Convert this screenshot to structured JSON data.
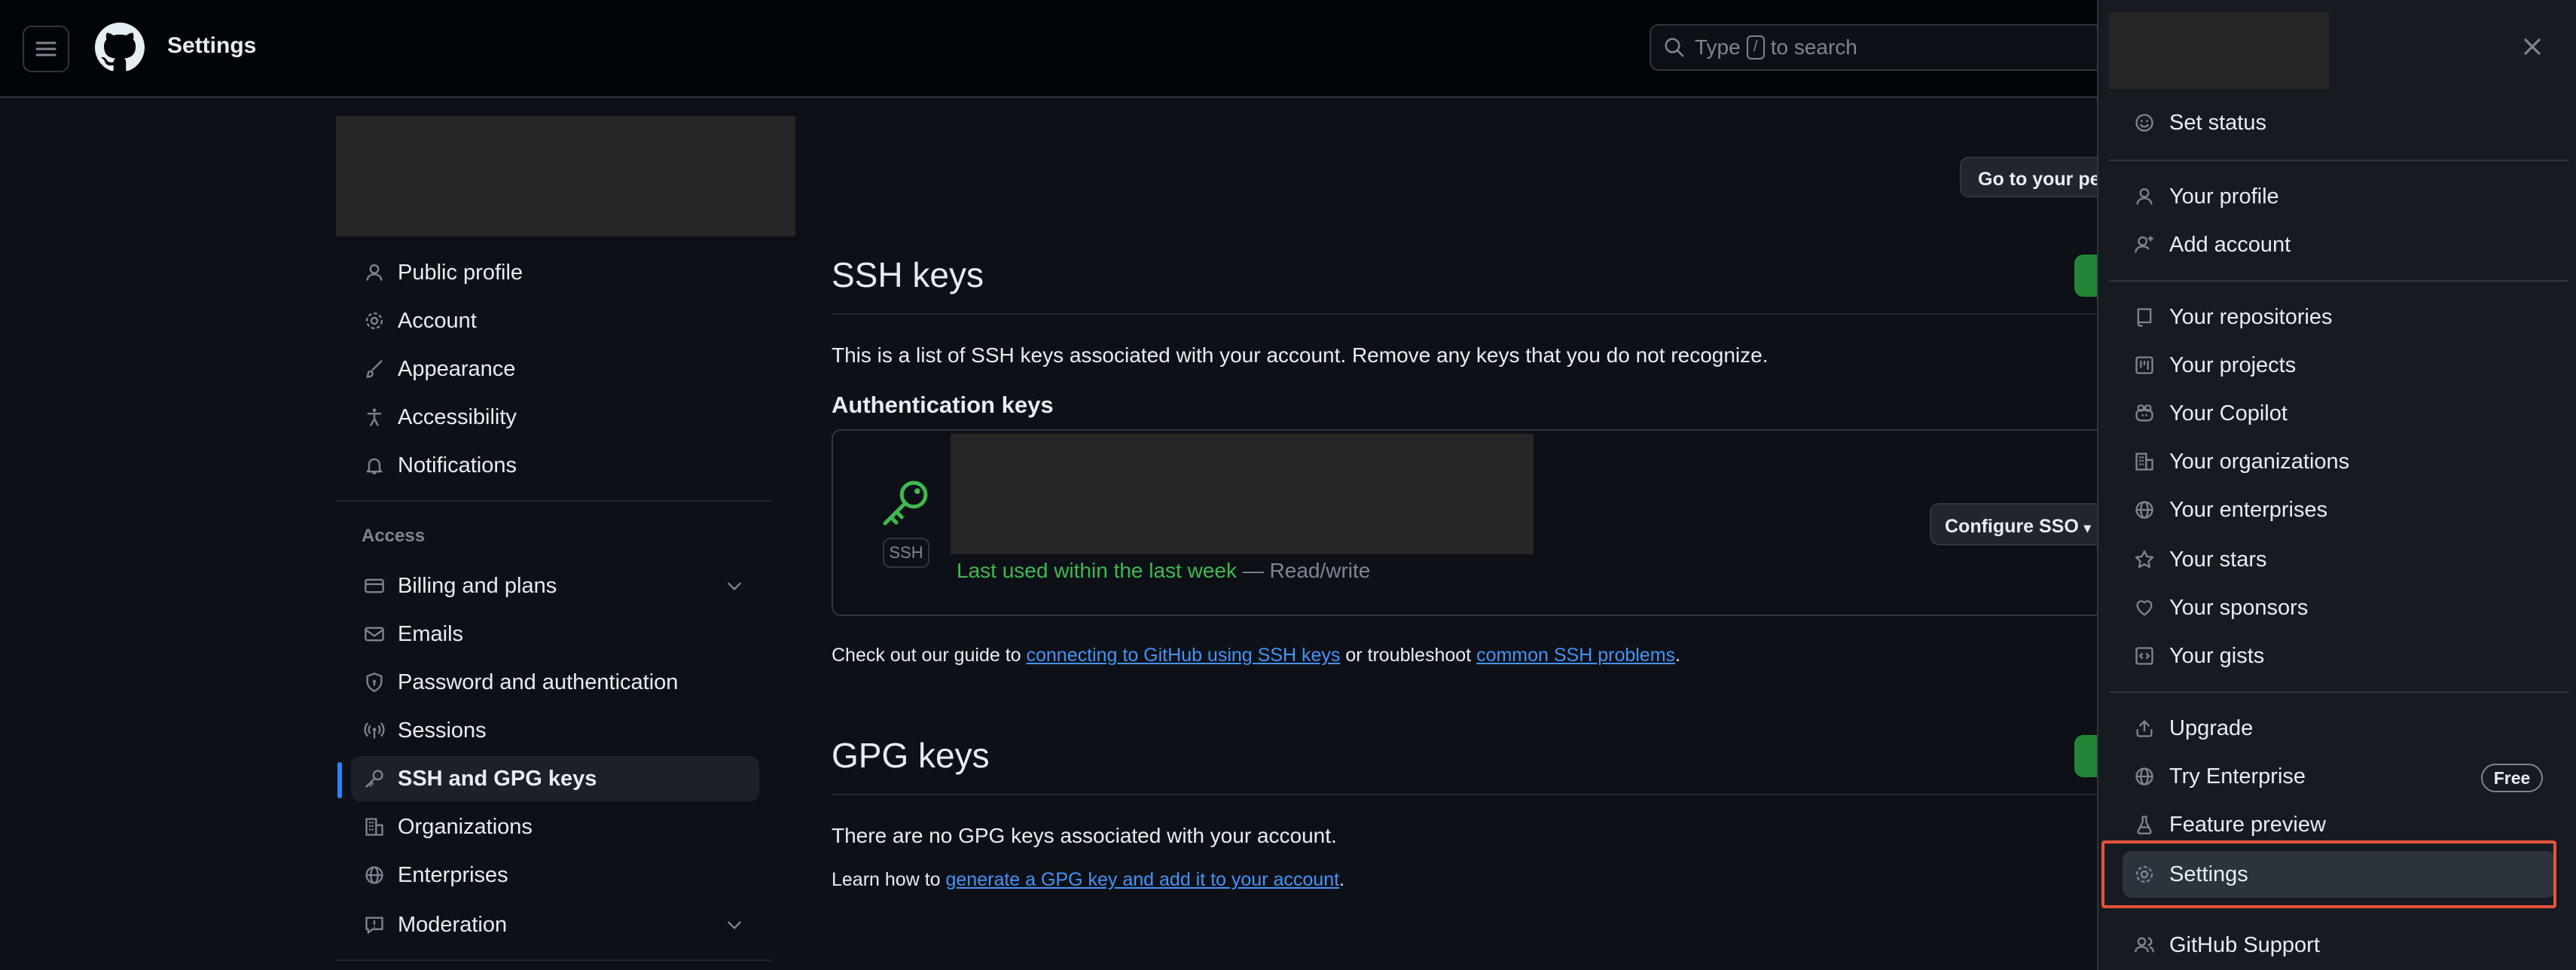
{
  "header": {
    "title": "Settings",
    "search_prefix": "Type",
    "search_key": "/",
    "search_suffix": "to search"
  },
  "sidebar": {
    "items": [
      {
        "label": "Public profile",
        "icon": "person-icon"
      },
      {
        "label": "Account",
        "icon": "gear-icon"
      },
      {
        "label": "Appearance",
        "icon": "paintbrush-icon"
      },
      {
        "label": "Accessibility",
        "icon": "accessibility-icon"
      },
      {
        "label": "Notifications",
        "icon": "bell-icon"
      }
    ],
    "access_heading": "Access",
    "access_items": [
      {
        "label": "Billing and plans",
        "icon": "credit-card-icon"
      },
      {
        "label": "Emails",
        "icon": "mail-icon"
      },
      {
        "label": "Password and authentication",
        "icon": "shield-lock-icon"
      },
      {
        "label": "Sessions",
        "icon": "broadcast-icon"
      },
      {
        "label": "SSH and GPG keys",
        "icon": "key-icon",
        "active": true
      },
      {
        "label": "Organizations",
        "icon": "organization-icon"
      },
      {
        "label": "Enterprises",
        "icon": "globe-icon"
      },
      {
        "label": "Moderation",
        "icon": "report-icon"
      }
    ]
  },
  "main": {
    "go_profile_label": "Go to your pe",
    "ssh": {
      "title": "SSH keys",
      "description": "This is a list of SSH keys associated with your account. Remove any keys that you do not recognize.",
      "auth_heading": "Authentication keys",
      "badge": "SSH",
      "last_used": "Last used within the last week",
      "access": " — Read/write",
      "configure_sso": "Configure SSO",
      "guide_prefix": "Check out our guide to ",
      "guide_link": "connecting to GitHub using SSH keys",
      "guide_middle": " or troubleshoot ",
      "guide_link2": "common SSH problems",
      "guide_suffix": "."
    },
    "gpg": {
      "title": "GPG keys",
      "empty": "There are no GPG keys associated with your account.",
      "learn_prefix": "Learn how to ",
      "learn_link": "generate a GPG key and add it to your account",
      "learn_suffix": "."
    }
  },
  "menu": {
    "set_status": "Set status",
    "group1": [
      "Your profile",
      "Add account"
    ],
    "group2": [
      "Your repositories",
      "Your projects",
      "Your Copilot",
      "Your organizations",
      "Your enterprises",
      "Your stars",
      "Your sponsors",
      "Your gists"
    ],
    "group3": [
      "Upgrade",
      "Try Enterprise",
      "Feature preview",
      "Settings"
    ],
    "free_badge": "Free",
    "support": "GitHub Support"
  },
  "colors": {
    "accent_link": "#4493f8",
    "green": "#238636",
    "highlight": "#e5533a",
    "last_used": "#3fb950"
  }
}
